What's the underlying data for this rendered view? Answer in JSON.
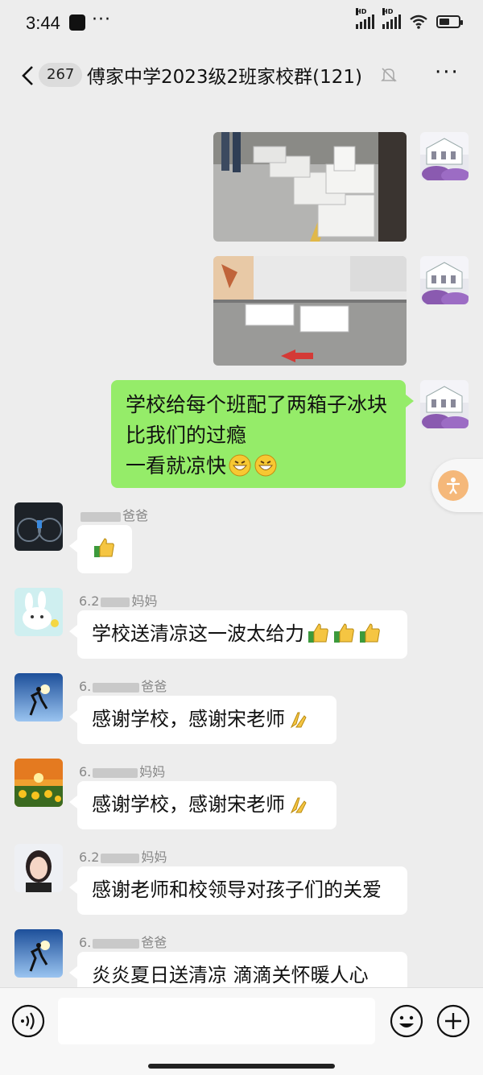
{
  "status_bar": {
    "time": "3:44",
    "more": "···",
    "battery_level": 0.55,
    "signal_badge": "HD"
  },
  "header": {
    "unread_count": "267",
    "title": "傅家中学2023级2班家校群(121)",
    "more": "···"
  },
  "messages": {
    "me_text": {
      "line1": "学校给每个班配了两箱子冰块",
      "line2": "比我们的过瘾",
      "line3": "一看就凉快"
    },
    "m1": {
      "name_suffix": "爸爸"
    },
    "m2": {
      "name_prefix": "6.2",
      "name_suffix": "妈妈",
      "text": "学校送清凉这一波太给力"
    },
    "m3": {
      "name_prefix": "6.",
      "name_suffix": "爸爸",
      "text": "感谢学校，感谢宋老师"
    },
    "m4": {
      "name_prefix": "6.",
      "name_suffix": "妈妈",
      "text": "感谢学校，感谢宋老师"
    },
    "m5": {
      "name_prefix": "6.2",
      "name_suffix": "妈妈",
      "text": "感谢老师和校领导对孩子们的关爱"
    },
    "m6": {
      "name_prefix": "6.",
      "name_suffix": "爸爸",
      "text": "炎炎夏日送清凉 滴滴关怀暖人心"
    }
  },
  "colors": {
    "my_bubble": "#95ec69",
    "background": "#ededed"
  }
}
